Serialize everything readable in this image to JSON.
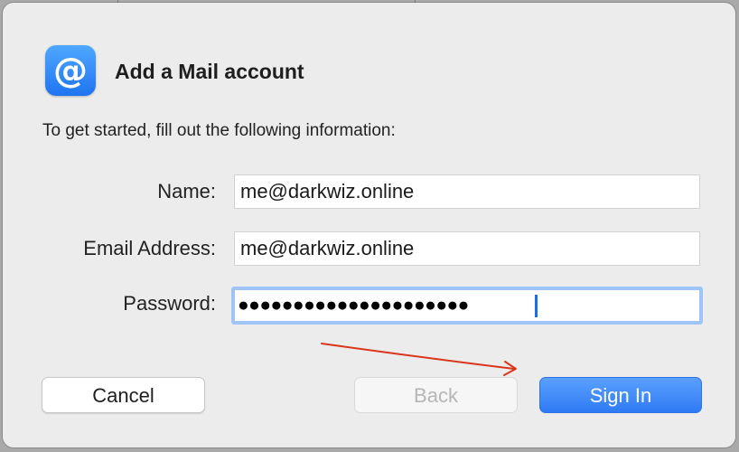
{
  "dialog": {
    "title": "Add a Mail account",
    "app_icon": "at-sign-icon",
    "app_icon_glyph": "@",
    "intro": "To get started, fill out the following information:"
  },
  "form": {
    "name_label": "Name:",
    "name_value": "me@darkwiz.online",
    "email_label": "Email Address:",
    "email_value": "me@darkwiz.online",
    "password_label": "Password:",
    "password_masked": "●●●●●●●●●●●●●●●●●●●●●"
  },
  "buttons": {
    "cancel_label": "Cancel",
    "back_label": "Back",
    "signin_label": "Sign In"
  },
  "annotation": {
    "arrow_color": "#d9361c"
  },
  "colors": {
    "accent": "#2f7bf5",
    "focus_ring": "#9fc4f7",
    "dialog_bg": "#ececec"
  }
}
